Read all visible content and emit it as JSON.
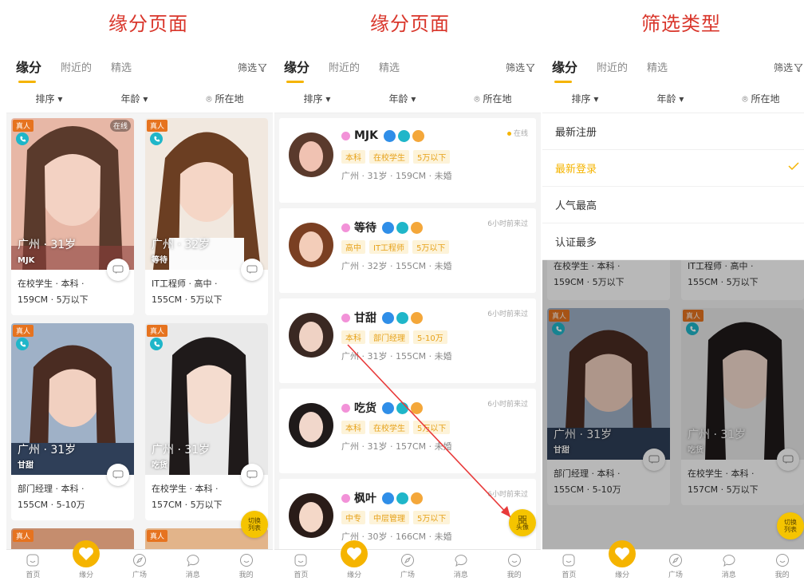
{
  "captions": [
    "缘分页面",
    "缘分页面",
    "筛选类型"
  ],
  "tabs": [
    "缘分",
    "附近的",
    "精选"
  ],
  "filter_label": "筛选",
  "sortbar": {
    "sort": "排序",
    "age": "年龄",
    "location": "所在地"
  },
  "grid_cards": [
    {
      "real": "真人",
      "online": "在线",
      "city_age": "广州 · 31岁",
      "nick": "MJK",
      "info1": "在校学生 · 本科 ·",
      "info2": "159CM · 5万以下"
    },
    {
      "real": "真人",
      "online": "",
      "city_age": "广州 · 32岁",
      "nick": "等待",
      "info1": "IT工程师 · 高中 ·",
      "info2": "155CM · 5万以下"
    },
    {
      "real": "真人",
      "online": "",
      "city_age": "广州 · 31岁",
      "nick": "甘甜",
      "info1": "部门经理 · 本科 ·",
      "info2": "155CM · 5-10万"
    },
    {
      "real": "真人",
      "online": "",
      "city_age": "广州 · 31岁",
      "nick": "吃货",
      "info1": "在校学生 · 本科 ·",
      "info2": "157CM · 5万以下"
    }
  ],
  "list_cards": [
    {
      "name": "MJK",
      "status": "在线",
      "tags": [
        "本科",
        "在校学生",
        "5万以下"
      ],
      "desc": "广州 · 31岁 · 159CM · 未婚"
    },
    {
      "name": "等待",
      "status": "6小时前来过",
      "tags": [
        "高中",
        "IT工程师",
        "5万以下"
      ],
      "desc": "广州 · 32岁 · 155CM · 未婚"
    },
    {
      "name": "甘甜",
      "status": "6小时前来过",
      "tags": [
        "本科",
        "部门经理",
        "5-10万"
      ],
      "desc": "广州 · 31岁 · 155CM · 未婚"
    },
    {
      "name": "吃货",
      "status": "6小时前来过",
      "tags": [
        "本科",
        "在校学生",
        "5万以下"
      ],
      "desc": "广州 · 31岁 · 157CM · 未婚"
    },
    {
      "name": "枫叶",
      "status": "6小时前来过",
      "tags": [
        "中专",
        "中层管理",
        "5万以下"
      ],
      "desc": "广州 · 30岁 · 166CM · 未婚"
    }
  ],
  "fab_list": [
    "切换",
    "列表"
  ],
  "fab_avatar": "头像",
  "dropdown_items": [
    "最新注册",
    "最新登录",
    "人气最高",
    "认证最多"
  ],
  "dropdown_selected_index": 1,
  "nav": [
    "首页",
    "缘分",
    "广场",
    "消息",
    "我的"
  ],
  "colors": {
    "accent": "#f5b400",
    "caption": "#d9362b",
    "real_badge": "#e6731f",
    "phone": "#1fb6c9"
  }
}
